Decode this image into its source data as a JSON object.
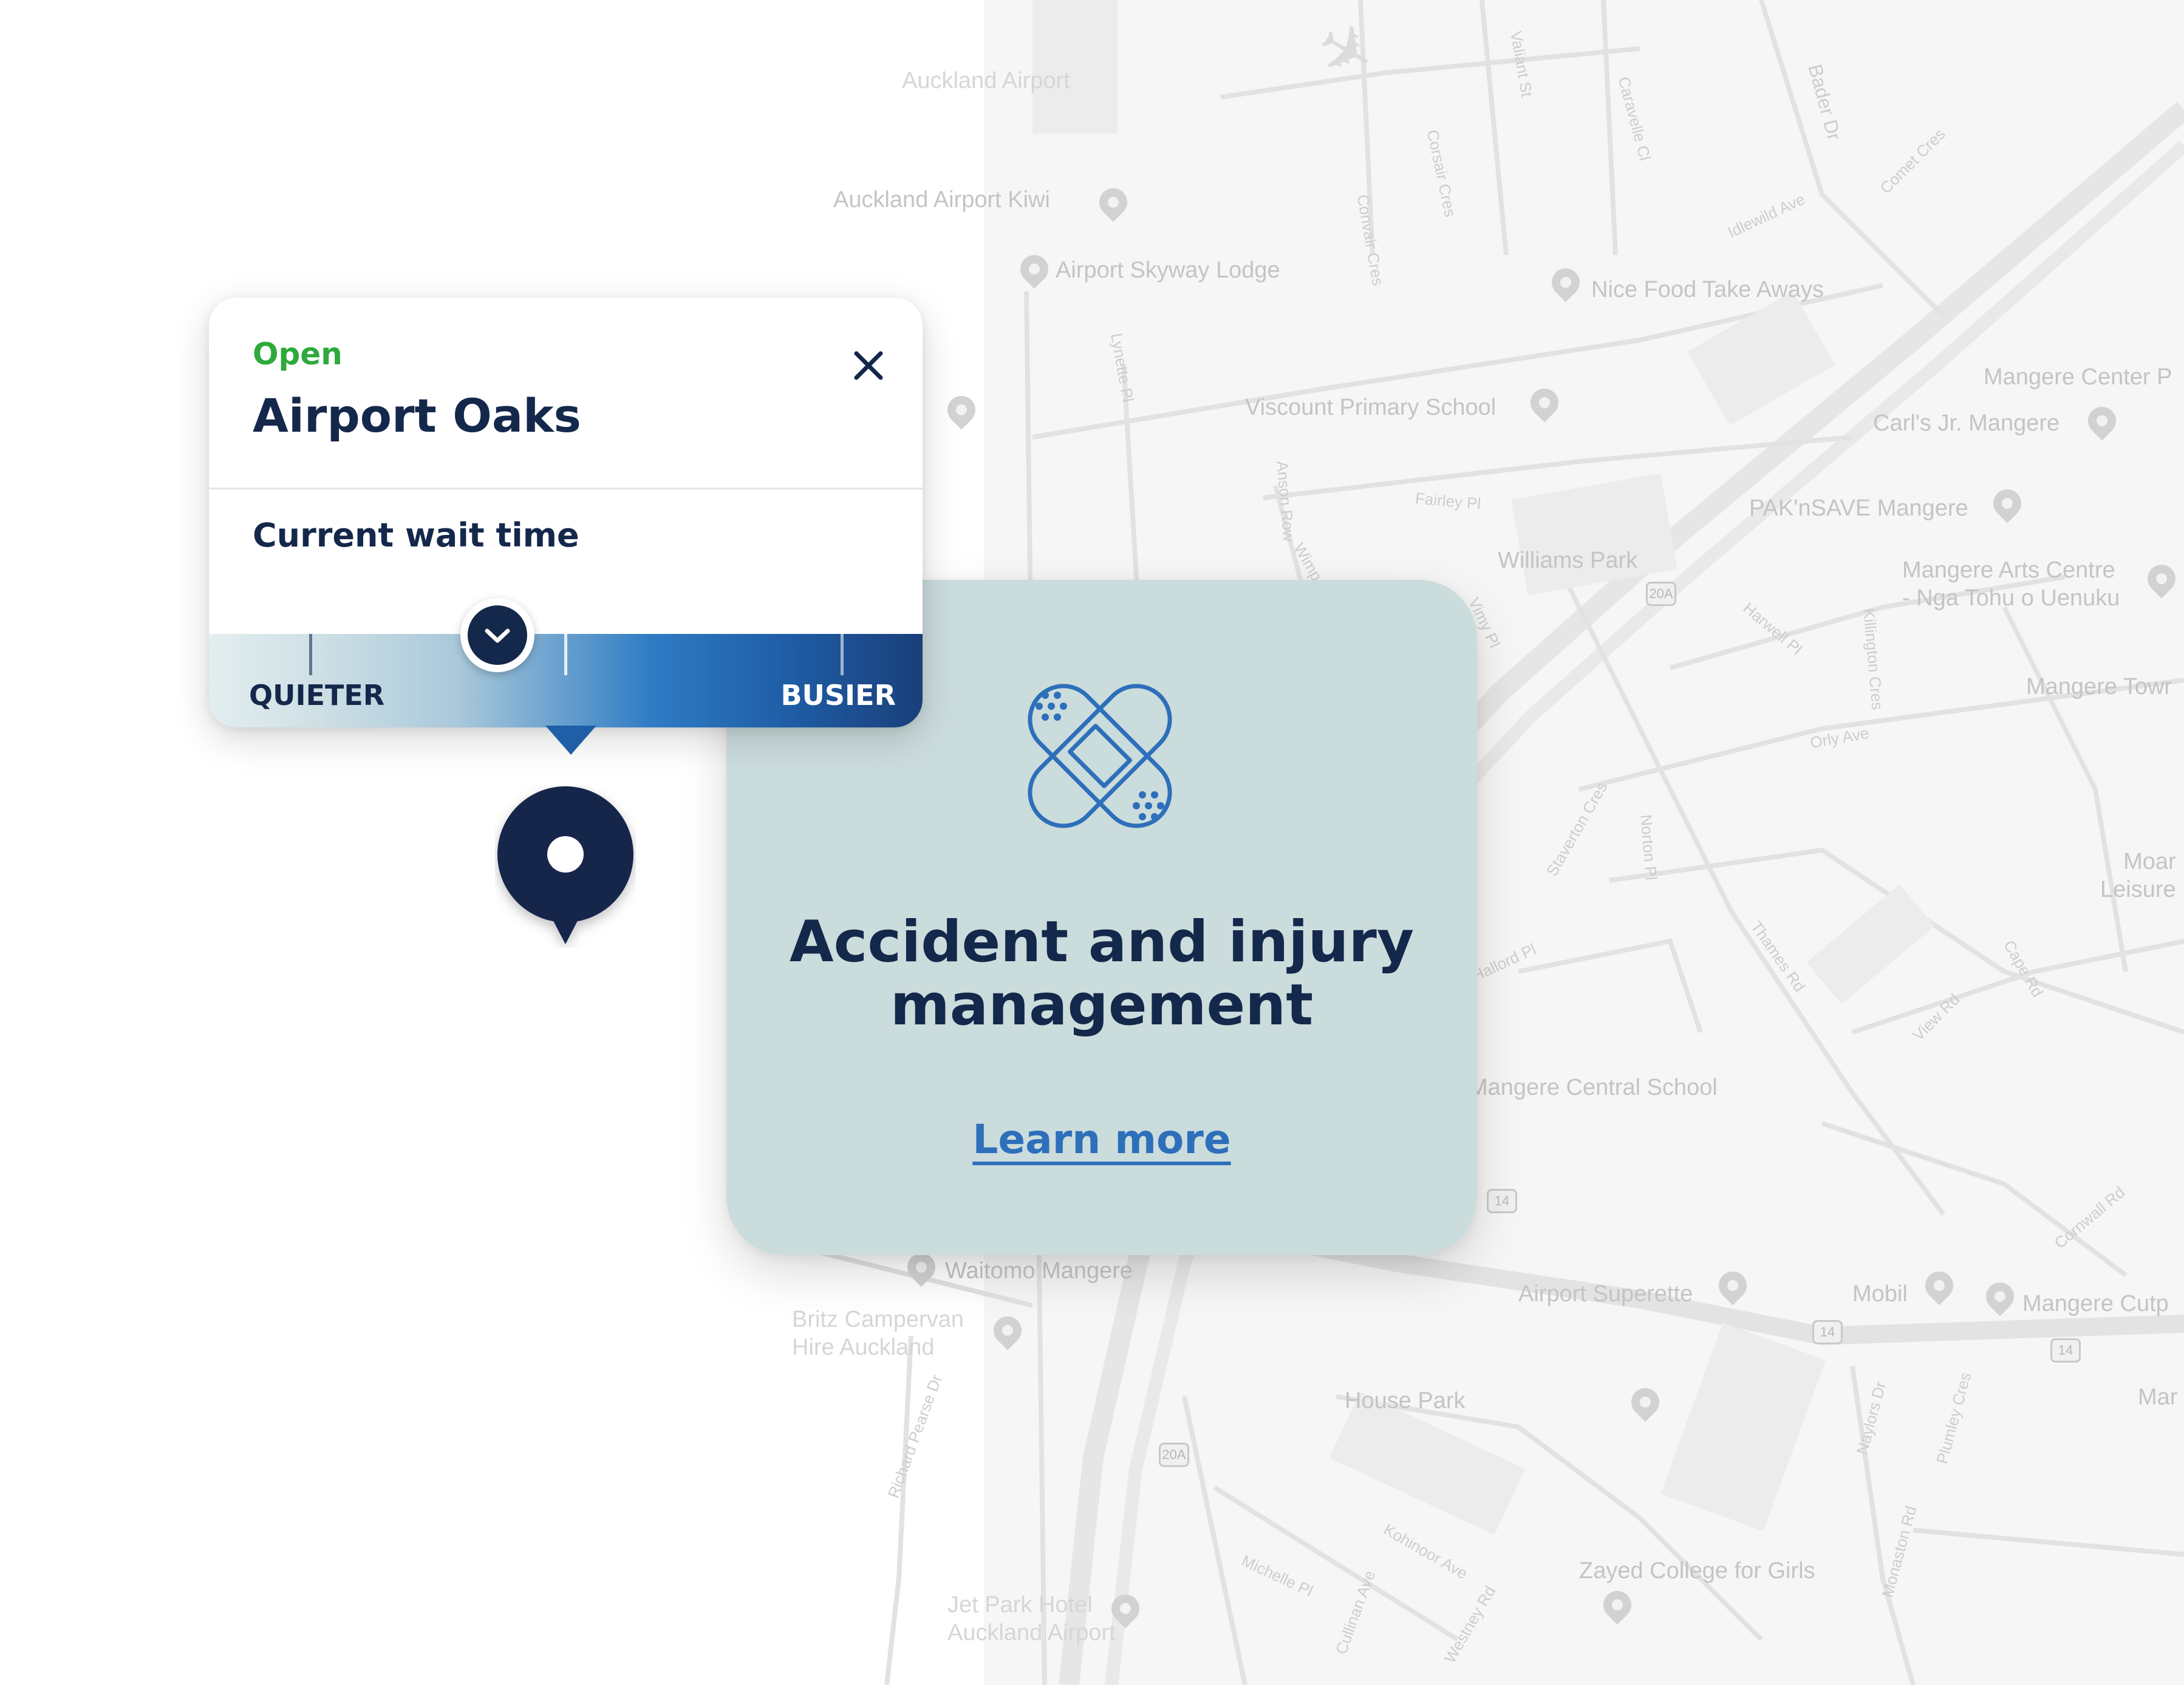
{
  "map": {
    "labels": [
      "Auckland Airport",
      "Auckland Airport Kiwi",
      "Airport Skyway Lodge",
      "Nice Food Take Aways",
      "Viscount Primary School",
      "Mangere Center P",
      "Carl's Jr. Mangere",
      "PAK'nSAVE Mangere",
      "Williams Park",
      "Mangere Arts Centre\n- Nga Tohu o Uenuku",
      "Mangere Towr",
      "Moar\nLeisure",
      "Mangere Central School",
      "Waitomo Mangere",
      "Britz Campervan\nHire Auckland",
      "Airport Superette",
      "Mobil",
      "Mangere Cutp",
      "House Park",
      "Mar",
      "Zayed College for Girls",
      "Jet Park Hotel\nAuckland Airport"
    ],
    "streets": [
      "Valiant St",
      "Caravelle Cl",
      "Bader Dr",
      "Corsair Cres",
      "Convair Cres",
      "Idlewild Ave",
      "Comet Cres",
      "Lynette Pl",
      "Fairley Pl",
      "Anson Row",
      "Harwell Pl",
      "Killington Cres",
      "Orly Ave",
      "Staverton Cres",
      "Norton Pl",
      "Thames Rd",
      "View Rd",
      "Cape Rd",
      "Cornwall Rd",
      "Hallord Pl",
      "Naylors Dr",
      "Plumley Cres",
      "Monaston Rd",
      "Kohinoor Ave",
      "Michelle Pl",
      "Cullinan Ave",
      "Westney Rd",
      "Richard Pearse Dr",
      "Vimy Pl",
      "Wimp"
    ],
    "shields": [
      "20A",
      "14",
      "14",
      "14",
      "20A"
    ]
  },
  "info_card": {
    "status": "Open",
    "location": "Airport Oaks",
    "wait_label": "Current wait time",
    "quieter_label": "QUIETER",
    "busier_label": "BUSIER",
    "wait_level": 0.38
  },
  "service_card": {
    "title": "Accident and injury management",
    "link_label": "Learn more",
    "icon": "bandage-icon"
  },
  "colors": {
    "navy": "#14284b",
    "open_green": "#2eaa3c",
    "link_blue": "#2d6fba",
    "service_card_bg": "#cbdcdc"
  }
}
